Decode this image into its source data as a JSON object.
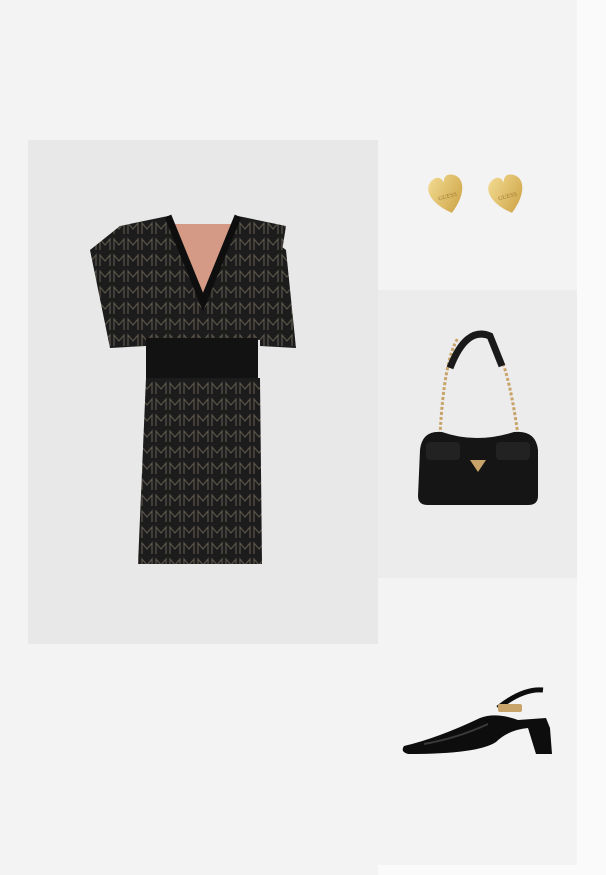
{
  "products": [
    {
      "name": "dress",
      "color": "#1c1c1c",
      "accent": "#d49a86",
      "pattern": "#5a5449"
    },
    {
      "name": "heart-earrings",
      "brand_engraving": "GUESS",
      "color": "#e6c56a"
    },
    {
      "name": "shoulder-bag",
      "brand_logo": "GUESS",
      "color": "#151515",
      "chain": "#c9a46a"
    },
    {
      "name": "slingback-pump",
      "color": "#0d0d0d",
      "buckle": "#c9a46a"
    }
  ]
}
